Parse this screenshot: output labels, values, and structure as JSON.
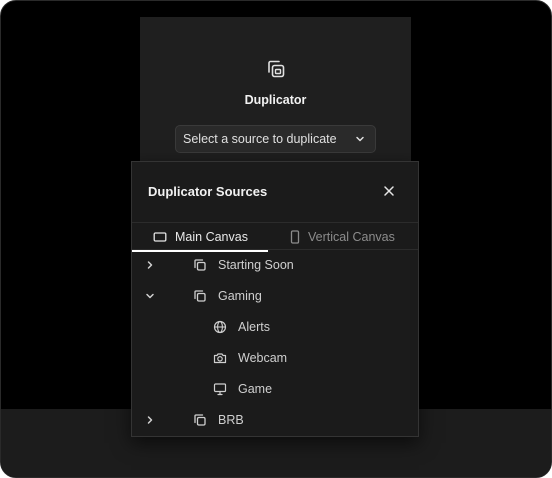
{
  "duplicator": {
    "icon": "duplicate-icon",
    "title": "Duplicator",
    "select_value": "Select a source to duplicate"
  },
  "dialog": {
    "title": "Duplicator Sources",
    "close_icon": "close-icon",
    "tabs": [
      {
        "label": "Main Canvas",
        "icon": "landscape-screen-icon",
        "active": true
      },
      {
        "label": "Vertical Canvas",
        "icon": "portrait-phone-icon",
        "active": false
      }
    ],
    "tree": [
      {
        "label": "Starting Soon",
        "icon": "duplicate-icon",
        "expander": "chevron-right-icon",
        "level": 0
      },
      {
        "label": "Gaming",
        "icon": "duplicate-icon",
        "expander": "chevron-down-icon",
        "level": 0
      },
      {
        "label": "Alerts",
        "icon": "globe-icon",
        "level": 1
      },
      {
        "label": "Webcam",
        "icon": "camera-icon",
        "level": 1
      },
      {
        "label": "Game",
        "icon": "monitor-icon",
        "level": 1
      },
      {
        "label": "BRB",
        "icon": "duplicate-icon",
        "expander": "chevron-right-icon",
        "level": 0
      }
    ]
  },
  "colors": {
    "background": "#000000",
    "panel": "#1f1f1f",
    "dialog": "#1b1b1b",
    "text": "#e6e6e6",
    "muted_text": "#8c8c8c",
    "tab_indicator": "#ffffff"
  }
}
